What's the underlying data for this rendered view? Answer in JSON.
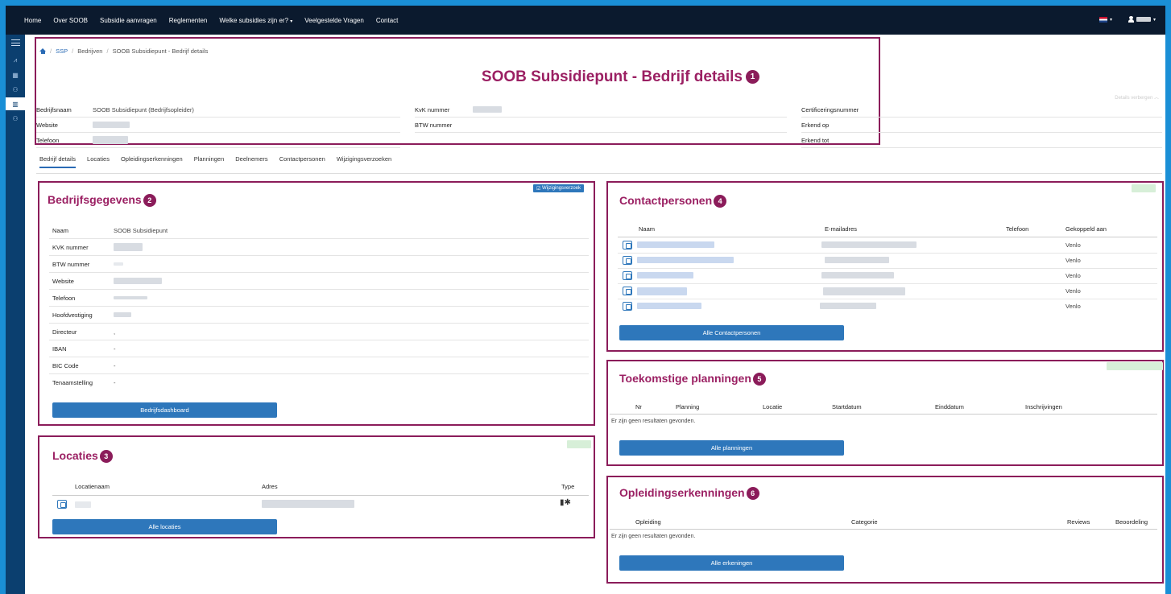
{
  "nav": {
    "items": [
      "Home",
      "Over SOOB",
      "Subsidie aanvragen",
      "Reglementen",
      "Welke subsidies zijn er?",
      "Veelgestelde Vragen",
      "Contact"
    ],
    "dropdown_caret": "▾"
  },
  "breadcrumb": {
    "items": [
      "SSP",
      "Bedrijven",
      "SOOB Subsidiepunt - Bedrijf details"
    ],
    "sep": "/"
  },
  "page": {
    "title": "SOOB Subsidiepunt - Bedrijf details",
    "badge": "1",
    "details_toggle": "Details verbergen ︿"
  },
  "details": {
    "bedrijfsnaam_label": "Bedrijfsnaam",
    "bedrijfsnaam_value": "SOOB Subsidiepunt (Bedrijfsopleider)",
    "website_label": "Website",
    "telefoon_label": "Telefoon",
    "kvk_label": "KvK nummer",
    "btw_label": "BTW nummer",
    "cert_label": "Certificeringsnummer",
    "erkend_op_label": "Erkend op",
    "erkend_tot_label": "Erkend tot"
  },
  "tabs": [
    "Bedrijf details",
    "Locaties",
    "Opleidingserkenningen",
    "Planningen",
    "Deelnemers",
    "Contactpersonen",
    "Wijzigingsverzoeken"
  ],
  "bedrijfsgegevens": {
    "title": "Bedrijfsgegevens",
    "badge": "2",
    "chip": "Wijzigingsverzoek",
    "rows": [
      {
        "label": "Naam",
        "value": "SOOB Subsidiepunt"
      },
      {
        "label": "KVK nummer",
        "value": ""
      },
      {
        "label": "BTW nummer",
        "value": ""
      },
      {
        "label": "Website",
        "value": ""
      },
      {
        "label": "Telefoon",
        "value": ""
      },
      {
        "label": "Hoofdvestiging",
        "value": ""
      },
      {
        "label": "Directeur",
        "value": ","
      },
      {
        "label": "IBAN",
        "value": "-"
      },
      {
        "label": "BIC Code",
        "value": "-"
      },
      {
        "label": "Tenaamstelling",
        "value": "-"
      }
    ],
    "button": "Bedrijfsdashboard"
  },
  "locaties": {
    "title": "Locaties",
    "badge": "3",
    "headers": [
      "Locatienaam",
      "Adres",
      "Type"
    ],
    "type_icons": "▮✱",
    "button": "Alle locaties"
  },
  "contactpersonen": {
    "title": "Contactpersonen",
    "badge": "4",
    "headers": [
      "Naam",
      "E-mailadres",
      "Telefoon",
      "Gekoppeld aan"
    ],
    "rows": [
      {
        "gekoppeld": "Venlo"
      },
      {
        "gekoppeld": "Venlo"
      },
      {
        "gekoppeld": "Venlo"
      },
      {
        "gekoppeld": "Venlo"
      },
      {
        "gekoppeld": "Venlo"
      }
    ],
    "button": "Alle Contactpersonen"
  },
  "planningen": {
    "title": "Toekomstige planningen",
    "badge": "5",
    "headers": [
      "Nr",
      "Planning",
      "Locatie",
      "Startdatum",
      "Einddatum",
      "Inschrijvingen"
    ],
    "empty": "Er zijn geen resultaten gevonden.",
    "button": "Alle planningen"
  },
  "erkenningen": {
    "title": "Opleidingserkenningen",
    "badge": "6",
    "headers": [
      "Opleiding",
      "Categorie",
      "Reviews",
      "Beoordeling"
    ],
    "empty": "Er zijn geen resultaten gevonden.",
    "button": "Alle erkeningen"
  },
  "colors": {
    "navbar": "#0b1a2e",
    "sidebar": "#0b3f6f",
    "frame": "#1a8fd6",
    "accent": "#9b2063",
    "highlight": "#8b1c5a",
    "button": "#2e77bb"
  }
}
